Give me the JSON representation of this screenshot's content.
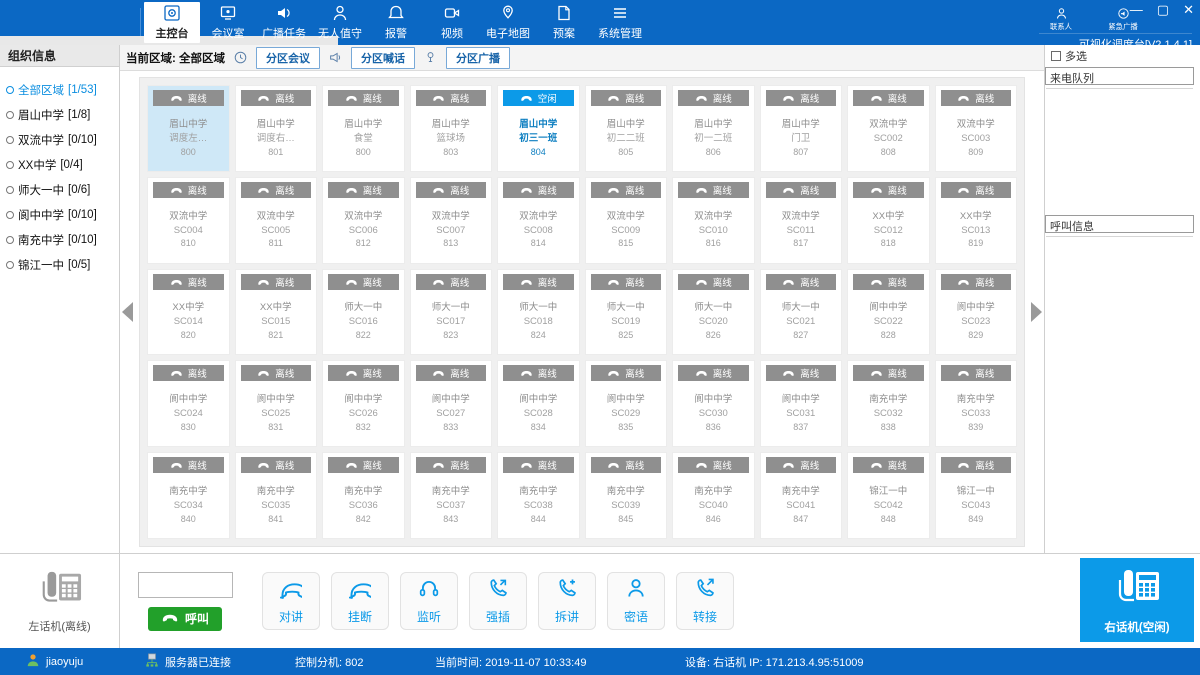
{
  "window": {
    "version_label": "可视化调度台[V2.1.4.1]",
    "minimize": "—",
    "maximize": "▢",
    "close": "✕"
  },
  "nav": {
    "items": [
      {
        "label": "主控台",
        "icon": "console-icon",
        "active": true
      },
      {
        "label": "会议室",
        "icon": "meeting-icon",
        "active": false
      },
      {
        "label": "广播任务",
        "icon": "broadcast-icon",
        "active": false
      },
      {
        "label": "无人值守",
        "icon": "unattended-icon",
        "active": false
      },
      {
        "label": "报警",
        "icon": "alarm-icon",
        "active": false
      },
      {
        "label": "视频",
        "icon": "video-icon",
        "active": false
      },
      {
        "label": "电子地图",
        "icon": "map-icon",
        "active": false
      },
      {
        "label": "预案",
        "icon": "plan-icon",
        "active": false
      },
      {
        "label": "系统管理",
        "icon": "settings-icon",
        "active": false
      }
    ],
    "right_items": [
      {
        "label": "联系人",
        "icon": "contacts-icon"
      },
      {
        "label": "紧急广播",
        "icon": "emergency-broadcast-icon"
      }
    ]
  },
  "sidebar": {
    "header": "组织信息",
    "items": [
      {
        "label": "全部区域",
        "count": "[1/53]",
        "selected": true
      },
      {
        "label": "眉山中学",
        "count": "[1/8]",
        "selected": false
      },
      {
        "label": "双流中学",
        "count": "[0/10]",
        "selected": false
      },
      {
        "label": "XX中学",
        "count": "[0/4]",
        "selected": false
      },
      {
        "label": "师大一中",
        "count": "[0/6]",
        "selected": false
      },
      {
        "label": "阆中中学",
        "count": "[0/10]",
        "selected": false
      },
      {
        "label": "南充中学",
        "count": "[0/10]",
        "selected": false
      },
      {
        "label": "锦江一中",
        "count": "[0/5]",
        "selected": false
      }
    ]
  },
  "toolbar": {
    "current_area_label": "当前区域: 全部区域",
    "clock_icon": "clock-icon",
    "megaphone_icon": "megaphone-icon",
    "horn_icon": "horn-icon",
    "btn_conference": "分区会议",
    "btn_shout": "分区喊话",
    "btn_broadcast": "分区广播"
  },
  "grid": {
    "status_offline": "离线",
    "status_idle": "空闲",
    "cards": [
      {
        "school": "眉山中学",
        "sub": "调度左…",
        "num": "800",
        "status": "离线",
        "selected": true
      },
      {
        "school": "眉山中学",
        "sub": "调度右…",
        "num": "801",
        "status": "离线",
        "selected": false
      },
      {
        "school": "眉山中学",
        "sub": "食堂",
        "num": "800",
        "status": "离线",
        "selected": false
      },
      {
        "school": "眉山中学",
        "sub": "篮球场",
        "num": "803",
        "status": "离线",
        "selected": false
      },
      {
        "school": "眉山中学",
        "sub": "初三一班",
        "num": "804",
        "status": "空闲",
        "selected": false
      },
      {
        "school": "眉山中学",
        "sub": "初二二班",
        "num": "805",
        "status": "离线",
        "selected": false
      },
      {
        "school": "眉山中学",
        "sub": "初一二班",
        "num": "806",
        "status": "离线",
        "selected": false
      },
      {
        "school": "眉山中学",
        "sub": "门卫",
        "num": "807",
        "status": "离线",
        "selected": false
      },
      {
        "school": "双流中学",
        "sub": "SC002",
        "num": "808",
        "status": "离线",
        "selected": false
      },
      {
        "school": "双流中学",
        "sub": "SC003",
        "num": "809",
        "status": "离线",
        "selected": false
      },
      {
        "school": "双流中学",
        "sub": "SC004",
        "num": "810",
        "status": "离线",
        "selected": false
      },
      {
        "school": "双流中学",
        "sub": "SC005",
        "num": "811",
        "status": "离线",
        "selected": false
      },
      {
        "school": "双流中学",
        "sub": "SC006",
        "num": "812",
        "status": "离线",
        "selected": false
      },
      {
        "school": "双流中学",
        "sub": "SC007",
        "num": "813",
        "status": "离线",
        "selected": false
      },
      {
        "school": "双流中学",
        "sub": "SC008",
        "num": "814",
        "status": "离线",
        "selected": false
      },
      {
        "school": "双流中学",
        "sub": "SC009",
        "num": "815",
        "status": "离线",
        "selected": false
      },
      {
        "school": "双流中学",
        "sub": "SC010",
        "num": "816",
        "status": "离线",
        "selected": false
      },
      {
        "school": "双流中学",
        "sub": "SC011",
        "num": "817",
        "status": "离线",
        "selected": false
      },
      {
        "school": "XX中学",
        "sub": "SC012",
        "num": "818",
        "status": "离线",
        "selected": false
      },
      {
        "school": "XX中学",
        "sub": "SC013",
        "num": "819",
        "status": "离线",
        "selected": false
      },
      {
        "school": "XX中学",
        "sub": "SC014",
        "num": "820",
        "status": "离线",
        "selected": false
      },
      {
        "school": "XX中学",
        "sub": "SC015",
        "num": "821",
        "status": "离线",
        "selected": false
      },
      {
        "school": "师大一中",
        "sub": "SC016",
        "num": "822",
        "status": "离线",
        "selected": false
      },
      {
        "school": "师大一中",
        "sub": "SC017",
        "num": "823",
        "status": "离线",
        "selected": false
      },
      {
        "school": "师大一中",
        "sub": "SC018",
        "num": "824",
        "status": "离线",
        "selected": false
      },
      {
        "school": "师大一中",
        "sub": "SC019",
        "num": "825",
        "status": "离线",
        "selected": false
      },
      {
        "school": "师大一中",
        "sub": "SC020",
        "num": "826",
        "status": "离线",
        "selected": false
      },
      {
        "school": "师大一中",
        "sub": "SC021",
        "num": "827",
        "status": "离线",
        "selected": false
      },
      {
        "school": "阆中中学",
        "sub": "SC022",
        "num": "828",
        "status": "离线",
        "selected": false
      },
      {
        "school": "阆中中学",
        "sub": "SC023",
        "num": "829",
        "status": "离线",
        "selected": false
      },
      {
        "school": "阆中中学",
        "sub": "SC024",
        "num": "830",
        "status": "离线",
        "selected": false
      },
      {
        "school": "阆中中学",
        "sub": "SC025",
        "num": "831",
        "status": "离线",
        "selected": false
      },
      {
        "school": "阆中中学",
        "sub": "SC026",
        "num": "832",
        "status": "离线",
        "selected": false
      },
      {
        "school": "阆中中学",
        "sub": "SC027",
        "num": "833",
        "status": "离线",
        "selected": false
      },
      {
        "school": "阆中中学",
        "sub": "SC028",
        "num": "834",
        "status": "离线",
        "selected": false
      },
      {
        "school": "阆中中学",
        "sub": "SC029",
        "num": "835",
        "status": "离线",
        "selected": false
      },
      {
        "school": "阆中中学",
        "sub": "SC030",
        "num": "836",
        "status": "离线",
        "selected": false
      },
      {
        "school": "阆中中学",
        "sub": "SC031",
        "num": "837",
        "status": "离线",
        "selected": false
      },
      {
        "school": "南充中学",
        "sub": "SC032",
        "num": "838",
        "status": "离线",
        "selected": false
      },
      {
        "school": "南充中学",
        "sub": "SC033",
        "num": "839",
        "status": "离线",
        "selected": false
      },
      {
        "school": "南充中学",
        "sub": "SC034",
        "num": "840",
        "status": "离线",
        "selected": false
      },
      {
        "school": "南充中学",
        "sub": "SC035",
        "num": "841",
        "status": "离线",
        "selected": false
      },
      {
        "school": "南充中学",
        "sub": "SC036",
        "num": "842",
        "status": "离线",
        "selected": false
      },
      {
        "school": "南充中学",
        "sub": "SC037",
        "num": "843",
        "status": "离线",
        "selected": false
      },
      {
        "school": "南充中学",
        "sub": "SC038",
        "num": "844",
        "status": "离线",
        "selected": false
      },
      {
        "school": "南充中学",
        "sub": "SC039",
        "num": "845",
        "status": "离线",
        "selected": false
      },
      {
        "school": "南充中学",
        "sub": "SC040",
        "num": "846",
        "status": "离线",
        "selected": false
      },
      {
        "school": "南充中学",
        "sub": "SC041",
        "num": "847",
        "status": "离线",
        "selected": false
      },
      {
        "school": "锦江一中",
        "sub": "SC042",
        "num": "848",
        "status": "离线",
        "selected": false
      },
      {
        "school": "锦江一中",
        "sub": "SC043",
        "num": "849",
        "status": "离线",
        "selected": false
      }
    ]
  },
  "right_panel": {
    "multiselect_label": "多选",
    "queue_title": "来电队列",
    "callinfo_title": "呼叫信息"
  },
  "bottom": {
    "left_phone_label": "左话机(离线)",
    "dial_value": "",
    "dial_placeholder": "",
    "call_button": "呼叫",
    "controls": [
      {
        "label": "对讲",
        "icon": "intercom-icon"
      },
      {
        "label": "挂断",
        "icon": "hangup-icon"
      },
      {
        "label": "监听",
        "icon": "headset-icon"
      },
      {
        "label": "强插",
        "icon": "barge-in-icon"
      },
      {
        "label": "拆讲",
        "icon": "add-call-icon"
      },
      {
        "label": "密语",
        "icon": "whisper-icon"
      },
      {
        "label": "转接",
        "icon": "transfer-icon"
      }
    ],
    "right_phone_label": "右话机(空闲)"
  },
  "status_bar": {
    "user": "jiaoyuju",
    "server": "服务器已连接",
    "extension": "控制分机: 802",
    "time": "当前时间: 2019-11-07 10:33:49",
    "device": "设备: 右话机 IP: 171.213.4.95:51009"
  },
  "colors": {
    "brand": "#0b68c4",
    "accent": "#0c9ae8",
    "offline": "#8f8f8f",
    "call": "#22a02a"
  }
}
